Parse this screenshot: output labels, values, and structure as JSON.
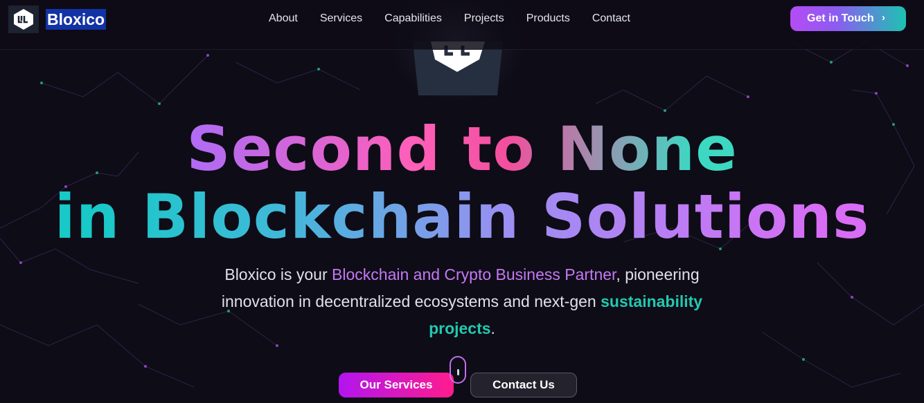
{
  "brand": {
    "name": "Bloxico",
    "logo_icon": "bloxico-logo-icon",
    "colors": {
      "brand_bg": "#1233a5"
    }
  },
  "nav": {
    "items": [
      {
        "label": "About"
      },
      {
        "label": "Services"
      },
      {
        "label": "Capabilities"
      },
      {
        "label": "Projects"
      },
      {
        "label": "Products"
      },
      {
        "label": "Contact"
      }
    ],
    "cta_label": "Get in Touch",
    "cta_icon": "chevron-right-icon"
  },
  "hero": {
    "title_line1": "Second to None",
    "title_line2": "in Blockchain Solutions",
    "sub_part1": "Bloxico is your ",
    "sub_highlight1": "Blockchain and Crypto Business Partner",
    "sub_part2": ", pioneering innovation in decentralized ecosystems and next-gen ",
    "sub_highlight2": "sustainability projects",
    "sub_part3": ".",
    "primary_button": "Our Services",
    "secondary_button": "Contact Us",
    "scroll_icon": "mouse-scroll-icon"
  },
  "theme": {
    "background": "#0e0c16",
    "accent_purple": "#c578f5",
    "accent_teal": "#22c9b0",
    "accent_pink": "#ff1c8c"
  }
}
